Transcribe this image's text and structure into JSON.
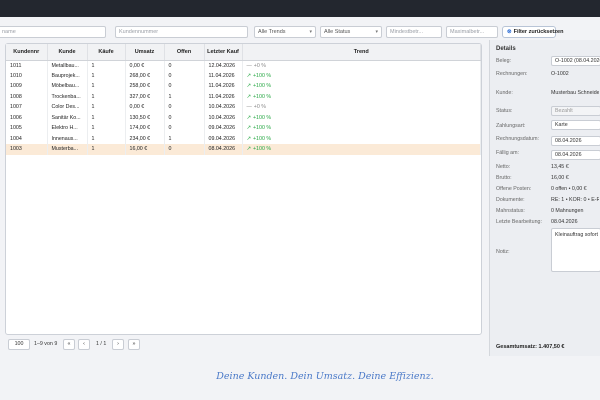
{
  "filters": {
    "name_placeholder": "name",
    "number_placeholder": "Kundennummer",
    "trend_select": "Alle Trends",
    "status_select": "Alle Status",
    "min_placeholder": "Mindestbetr...",
    "max_placeholder": "Maximalbetr...",
    "reset_label": "Filter zurücksetzen"
  },
  "table": {
    "columns": [
      "Kundennr",
      "Kunde",
      "Käufe",
      "Umsatz",
      "Offen",
      "Letzter Kauf",
      "Trend"
    ],
    "rows": [
      {
        "nr": "1011",
        "kunde": "Metallbau...",
        "kaeufe": "1",
        "umsatz": "0,00 €",
        "offen": "0",
        "letzter": "12.04.2026",
        "trend": "+0 %",
        "dir": "flat"
      },
      {
        "nr": "1010",
        "kunde": "Bauprojek...",
        "kaeufe": "1",
        "umsatz": "268,00 €",
        "offen": "0",
        "letzter": "11.04.2026",
        "trend": "+100 %",
        "dir": "up"
      },
      {
        "nr": "1009",
        "kunde": "Möbelbau...",
        "kaeufe": "1",
        "umsatz": "258,00 €",
        "offen": "0",
        "letzter": "11.04.2026",
        "trend": "+100 %",
        "dir": "up"
      },
      {
        "nr": "1008",
        "kunde": "Trockenba...",
        "kaeufe": "1",
        "umsatz": "327,00 €",
        "offen": "1",
        "letzter": "11.04.2026",
        "trend": "+100 %",
        "dir": "up"
      },
      {
        "nr": "1007",
        "kunde": "Color Des...",
        "kaeufe": "1",
        "umsatz": "0,00 €",
        "offen": "0",
        "letzter": "10.04.2026",
        "trend": "+0 %",
        "dir": "flat"
      },
      {
        "nr": "1006",
        "kunde": "Sanitär Ko...",
        "kaeufe": "1",
        "umsatz": "130,50 €",
        "offen": "0",
        "letzter": "10.04.2026",
        "trend": "+100 %",
        "dir": "up"
      },
      {
        "nr": "1005",
        "kunde": "Elektro H...",
        "kaeufe": "1",
        "umsatz": "174,00 €",
        "offen": "0",
        "letzter": "09.04.2026",
        "trend": "+100 %",
        "dir": "up"
      },
      {
        "nr": "1004",
        "kunde": "Innenaus...",
        "kaeufe": "1",
        "umsatz": "234,00 €",
        "offen": "1",
        "letzter": "09.04.2026",
        "trend": "+100 %",
        "dir": "up"
      },
      {
        "nr": "1003",
        "kunde": "Musterba...",
        "kaeufe": "1",
        "umsatz": "16,00 €",
        "offen": "0",
        "letzter": "08.04.2026",
        "trend": "+100 %",
        "dir": "up"
      }
    ]
  },
  "pager": {
    "page_size": "100",
    "range": "1–9 von 9",
    "first": "«",
    "prev": "‹",
    "page": "1 / 1",
    "next": "›",
    "last": "»"
  },
  "details": {
    "title": "Details",
    "beleg_label": "Beleg:",
    "beleg_value": "O-1002 (08.04.2026)",
    "rechnungen_label": "Rechnungen:",
    "rechnungen_value": "O-1002",
    "kunde_label": "Kunde:",
    "kunde_value": "Musterbau Schneider",
    "status_label": "Status:",
    "status_value": "Bezahlt",
    "zahlungsart_label": "Zahlungsart:",
    "zahlungsart_value": "Karte",
    "rechnungsdatum_label": "Rechnungsdatum:",
    "rechnungsdatum_value": "08.04.2026",
    "faellig_label": "Fällig am:",
    "faellig_value": "08.04.2026",
    "netto_label": "Netto:",
    "netto_value": "13,45 €",
    "brutto_label": "Brutto:",
    "brutto_value": "16,00 €",
    "offene_label": "Offene Posten:",
    "offene_value": "0 offen • 0,00 €",
    "dokumente_label": "Dokumente:",
    "dokumente_value": "RE: 1 • KOR: 0 • E-R",
    "mahnstatus_label": "Mahnstatus:",
    "mahnstatus_value": "0 Mahnungen",
    "bearbeitung_label": "Letzte Bearbeitung:",
    "bearbeitung_value": "08.04.2026",
    "notiz_label": "Notiz:",
    "notiz_value": "Kleinauftrag sofort",
    "gesamt": "Gesamtumsatz: 1.407,50 €"
  },
  "slogan": "Deine Kunden. Dein Umsatz. Deine Effizienz.",
  "colors": {
    "accent": "#2f6fd6",
    "trend_up": "#27a844",
    "selected_row": "#fbead7",
    "topbar": "#23272f"
  }
}
